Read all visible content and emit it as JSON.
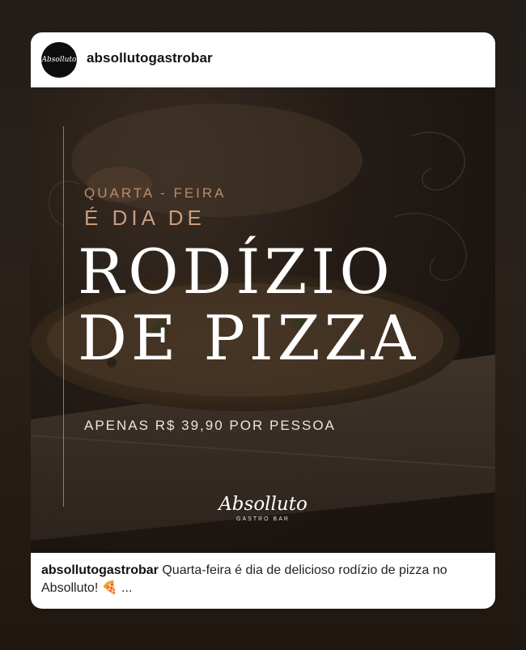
{
  "header": {
    "avatar_text": "Absolluto",
    "username": "absollutogastrobar"
  },
  "post": {
    "pretitle_line1": "QUARTA - FEIRA",
    "pretitle_line2": "É DIA DE",
    "title_line1": "RODÍZIO",
    "title_line2": "DE PIZZA",
    "price_text": "APENAS R$ 39,90 POR PESSOA",
    "logo_text": "Absolluto",
    "logo_subtext": "GASTRO BAR"
  },
  "caption": {
    "username": "absollutogastrobar",
    "text": "Quarta-feira é dia de delicioso rodízio de pizza no Absolluto! 🍕 ..."
  },
  "colors": {
    "accent_text": "#c99c7f",
    "background": "#221d19"
  }
}
